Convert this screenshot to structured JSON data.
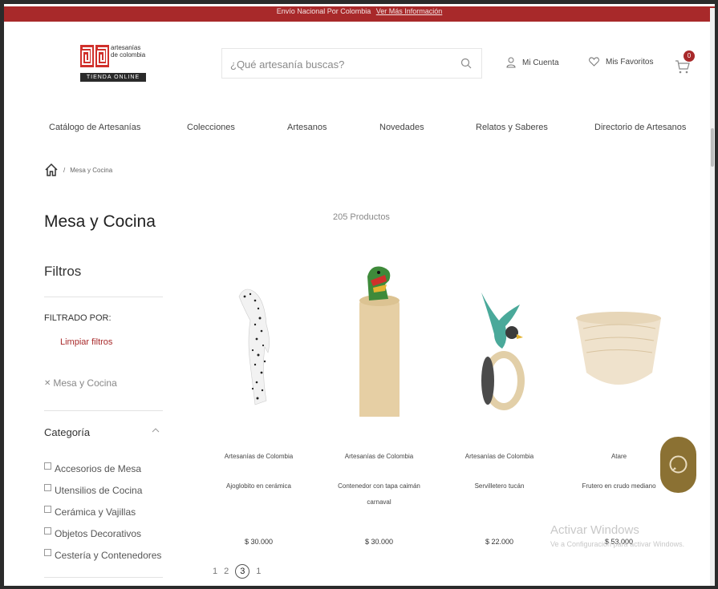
{
  "topbar": {
    "text": "Envío Nacional Por Colombia",
    "link": "Ver Más Información"
  },
  "logo": {
    "line1": "artesanías",
    "line2": "de colombia",
    "bar": "TIENDA ONLINE"
  },
  "search": {
    "placeholder": "¿Qué artesanía buscas?"
  },
  "header": {
    "account": "Mi Cuenta",
    "favorites": "Mis Favoritos",
    "cart_count": "0"
  },
  "nav": [
    "Catálogo de Artesanías",
    "Colecciones",
    "Artesanos",
    "Novedades",
    "Relatos y Saberes",
    "Directorio de Artesanos"
  ],
  "breadcrumb": {
    "current": "Mesa y Cocina"
  },
  "page": {
    "title": "Mesa y Cocina",
    "count": "205 Productos"
  },
  "filters": {
    "title": "Filtros",
    "filtered_by": "FILTRADO POR:",
    "clear": "Limpiar filtros",
    "applied": "Mesa y Cocina",
    "category_title": "Categoría",
    "categories": [
      "Accesorios de Mesa",
      "Utensilios de Cocina",
      "Cerámica y Vajillas",
      "Objetos Decorativos",
      "Cestería y Contenedores"
    ]
  },
  "products": [
    {
      "brand": "Artesanías de Colombia",
      "name": "Ajoglobito en cerámica",
      "name2": "",
      "price": "$ 30.000"
    },
    {
      "brand": "Artesanías de Colombia",
      "name": "Contenedor con tapa caimán",
      "name2": "carnaval",
      "price": "$ 30.000"
    },
    {
      "brand": "Artesanías de Colombia",
      "name": "Servilletero tucán",
      "name2": "",
      "price": "$ 22.000"
    },
    {
      "brand": "Atare",
      "name": "Frutero en crudo mediano",
      "name2": "",
      "price": "$ 53.000"
    }
  ],
  "pagination": {
    "prev": "1",
    "mid": "2",
    "current": "3",
    "next": "1"
  },
  "watermark": {
    "line1": "Activar Windows",
    "line2": "Ve a Configuración para activar Windows."
  },
  "colors": {
    "accent": "#a8292a",
    "chat": "#8b7133"
  },
  "icons": [
    "home-icon",
    "search-icon",
    "user-icon",
    "heart-icon",
    "cart-icon",
    "chevron-up-icon",
    "chat-icon"
  ]
}
